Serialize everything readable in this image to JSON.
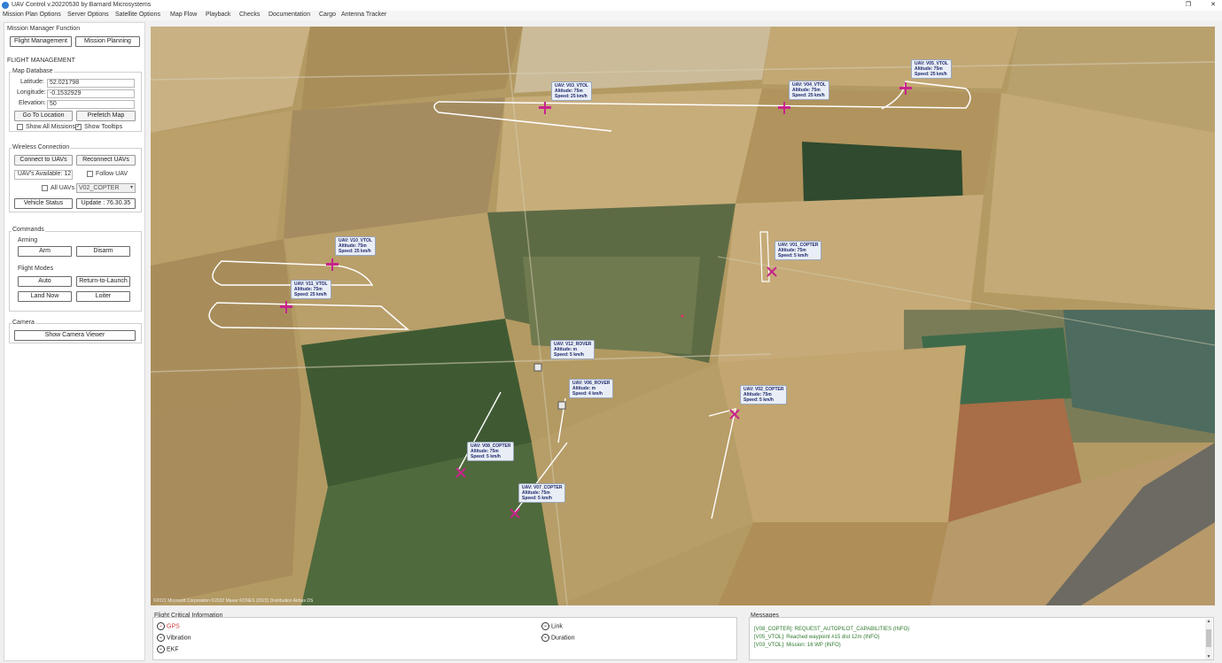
{
  "window": {
    "title": "UAV Control v.20220530 by Barnard Microsystems",
    "maximize_icon": "maximize-icon",
    "close_icon": "close-icon"
  },
  "menu": [
    "Mission Plan Options",
    "Server Options",
    "Satellite Options",
    "Map Flow",
    "Playback",
    "Checks",
    "Documentation",
    "Cargo",
    "Antenna Tracker"
  ],
  "left": {
    "mission_manager_title": "Mission Manager Function",
    "flight_management_btn": "Flight Management",
    "mission_planning_btn": "Mission Planning",
    "flight_management_header": "FLIGHT MANAGEMENT",
    "map_database_title": "Map Database",
    "latitude_label": "Latitude:",
    "latitude_value": "52.021798",
    "longitude_label": "Longitude:",
    "longitude_value": "-0.1532929",
    "elevation_label": "Elevation:",
    "elevation_value": "50",
    "go_to_location_btn": "Go To Location",
    "prefetch_map_btn": "Prefetch Map",
    "show_all_missions_label": "Show All Missions",
    "show_tooltips_label": "Show Tooltips",
    "show_all_missions_checked": false,
    "show_tooltips_checked": true,
    "wireless_title": "Wireless Connection",
    "connect_btn": "Connect to UAVs",
    "reconnect_btn": "Reconnect UAVs",
    "uavs_available": "UAV's Available: 12",
    "follow_uav_label": "Follow UAV",
    "all_uavs_label": "All UAVs",
    "uav_select_value": "V02_COPTER",
    "vehicle_status_btn": "Vehicle Status",
    "update_btn": "Update : 76.30.35",
    "commands_title": "Commands",
    "arming_title": "Arming",
    "arm_btn": "Arm",
    "disarm_btn": "Disarm",
    "flight_modes_title": "Flight Modes",
    "auto_btn": "Auto",
    "return_to_launch_btn": "Return-to-Launch",
    "land_now_btn": "Land Now",
    "loiter_btn": "Loiter",
    "camera_title": "Camera",
    "show_camera_viewer_btn": "Show Camera Viewer"
  },
  "map": {
    "copyright": "©2022 Microsoft Corporation ©2022 Maxar ©CNES (2022) Distribution Airbus DS",
    "uavs": [
      {
        "name": "UAV: V03_VTOL",
        "altitude": "Altitude: 75m",
        "speed": "Speed: 25 km/h",
        "type": "plane"
      },
      {
        "name": "UAV: V04_VTOL",
        "altitude": "Altitude: 75m",
        "speed": "Speed: 25 km/h",
        "type": "plane"
      },
      {
        "name": "UAV: V05_VTOL",
        "altitude": "Altitude: 75m",
        "speed": "Speed: 25 km/h",
        "type": "plane"
      },
      {
        "name": "UAV: V10_VTOL",
        "altitude": "Altitude: 75m",
        "speed": "Speed: 25 km/h",
        "type": "plane"
      },
      {
        "name": "UAV: V11_VTOL",
        "altitude": "Altitude: 75m",
        "speed": "Speed: 25 km/h",
        "type": "plane"
      },
      {
        "name": "UAV: V01_COPTER",
        "altitude": "Altitude: 75m",
        "speed": "Speed: 5 km/h",
        "type": "copter"
      },
      {
        "name": "UAV: V12_ROVER",
        "altitude": "Altitude: m",
        "speed": "Speed: 5 km/h",
        "type": "rover"
      },
      {
        "name": "UAV: V06_ROVER",
        "altitude": "Altitude: m",
        "speed": "Speed: 4 km/h",
        "type": "rover"
      },
      {
        "name": "UAV: V02_COPTER",
        "altitude": "Altitude: 75m",
        "speed": "Speed: 5 km/h",
        "type": "copter"
      },
      {
        "name": "UAV: V08_COPTER",
        "altitude": "Altitude: 75m",
        "speed": "Speed: 5 km/h",
        "type": "copter"
      },
      {
        "name": "UAV: V07_COPTER",
        "altitude": "Altitude: 75m",
        "speed": "Speed: 5 km/h",
        "type": "copter"
      }
    ]
  },
  "flight_info": {
    "title": "Flight Critical Information",
    "gps": "GPS",
    "vibration": "Vibration",
    "ekf": "EKF",
    "link": "Link",
    "duration": "Duration",
    "gps_color": "#d23b3b",
    "normal_color": "#333333"
  },
  "messages": {
    "title": "Messages",
    "lines": [
      "[V08_COPTER]: REQUEST_AUTOPILOT_CAPABILITIES (INFO)",
      "[V05_VTOL]: Reached waypoint #15 dist 12m (INFO)",
      "[V03_VTOL]: Mission: 16 WP (INFO)"
    ]
  }
}
